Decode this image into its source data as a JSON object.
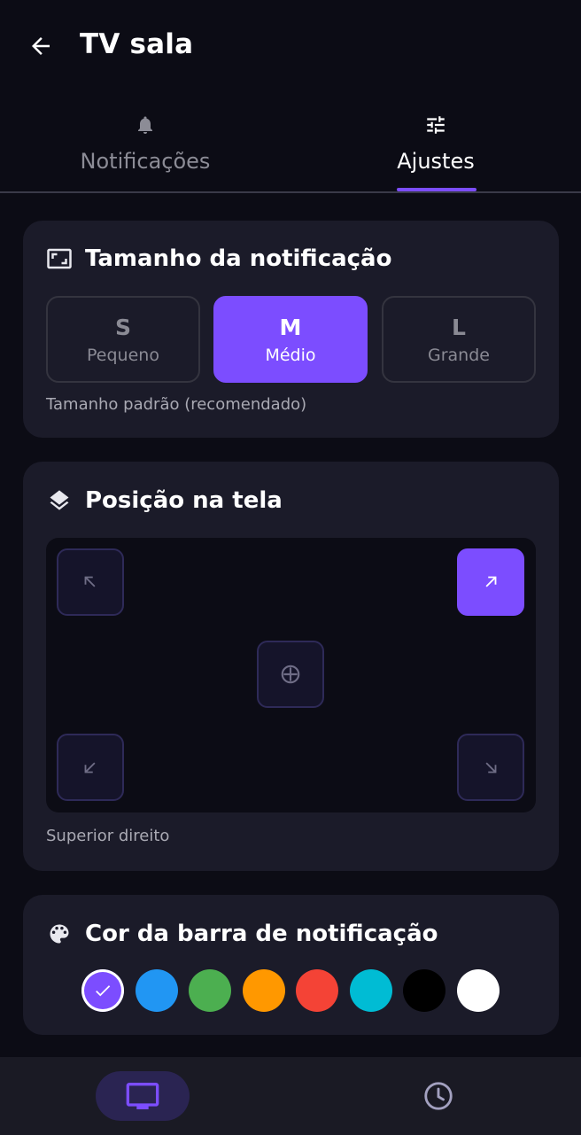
{
  "header": {
    "title": "TV sala",
    "back_icon": "arrow-left-icon"
  },
  "tabs": [
    {
      "label": "Notificações",
      "icon": "bell-icon",
      "active": false
    },
    {
      "label": "Ajustes",
      "icon": "sliders-icon",
      "active": true
    }
  ],
  "size_card": {
    "title": "Tamanho da notificação",
    "icon": "resize-frame-icon",
    "options": [
      {
        "letter": "S",
        "label": "Pequeno",
        "selected": false
      },
      {
        "letter": "M",
        "label": "Médio",
        "selected": true
      },
      {
        "letter": "L",
        "label": "Grande",
        "selected": false
      }
    ],
    "hint": "Tamanho padrão (recomendado)"
  },
  "position_card": {
    "title": "Posição na tela",
    "icon": "layers-icon",
    "options": [
      "top-left",
      "top-right",
      "center",
      "bottom-left",
      "bottom-right"
    ],
    "selected": "top-right",
    "hint": "Superior direito"
  },
  "color_card": {
    "title": "Cor da barra de notificação",
    "icon": "palette-icon",
    "colors": [
      "#7c4dff",
      "#2196f3",
      "#4caf50",
      "#ff9800",
      "#f44336",
      "#00bcd4",
      "#000000",
      "#ffffff"
    ],
    "selected_index": 0
  },
  "bottom_nav": [
    {
      "icon": "tv-icon",
      "active": true
    },
    {
      "icon": "clock-icon",
      "active": false
    }
  ],
  "colors": {
    "accent": "#7c4dff",
    "background": "#0c0c15",
    "card": "#1b1b29"
  }
}
